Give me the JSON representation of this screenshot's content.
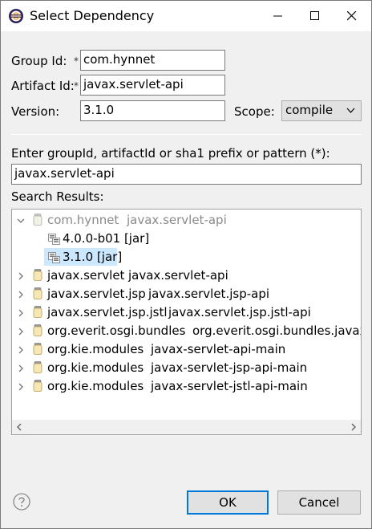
{
  "window": {
    "title": "Select Dependency"
  },
  "form": {
    "group_id_label": "Group Id:",
    "group_id_value": "com.hynnet",
    "artifact_id_label": "Artifact Id:",
    "artifact_id_value": "javax.servlet-api",
    "required_mark": "*",
    "version_label": "Version:",
    "version_value": "3.1.0",
    "scope_label": "Scope:",
    "scope_value": "compile"
  },
  "search": {
    "prompt": "Enter groupId, artifactId or sha1 prefix or pattern (*):",
    "value": "javax.servlet-api",
    "results_label": "Search Results:"
  },
  "results": [
    {
      "group": "com.hynnet",
      "artifact": "javax.servlet-api",
      "expanded": true,
      "children": [
        {
          "label": "4.0.0-b01 [jar]"
        },
        {
          "label": "3.1.0 [jar]",
          "selected": true
        }
      ]
    },
    {
      "group": "javax.servlet",
      "artifact": "javax.servlet-api"
    },
    {
      "group": "javax.servlet.jsp",
      "artifact": "javax.servlet.jsp-api"
    },
    {
      "group": "javax.servlet.jsp.jstl",
      "artifact": "javax.servlet.jsp.jstl-api"
    },
    {
      "group": "org.everit.osgi.bundles",
      "artifact": "org.everit.osgi.bundles.javax"
    },
    {
      "group": "org.kie.modules",
      "artifact": "javax-servlet-api-main"
    },
    {
      "group": "org.kie.modules",
      "artifact": "javax-servlet-jsp-api-main"
    },
    {
      "group": "org.kie.modules",
      "artifact": "javax-servlet-jstl-api-main"
    }
  ],
  "buttons": {
    "ok": "OK",
    "cancel": "Cancel"
  },
  "colors": {
    "selection": "#cce8ff",
    "default_button_border": "#0078d7",
    "muted_text": "#8a8a8a"
  }
}
